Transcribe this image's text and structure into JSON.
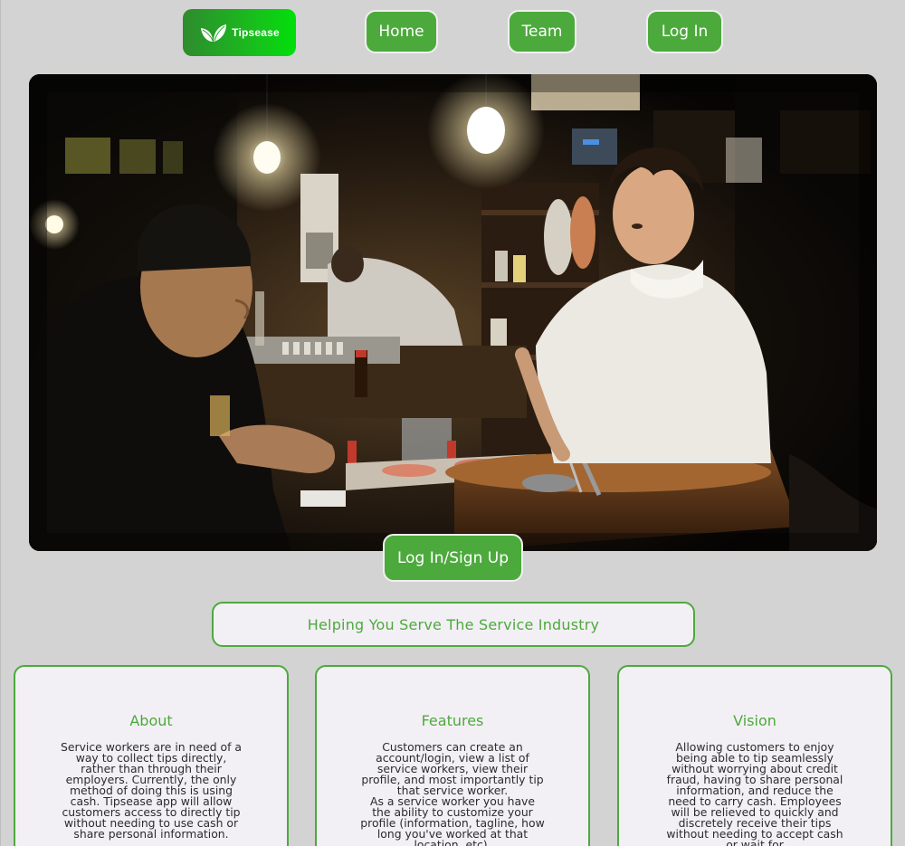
{
  "nav": {
    "logo_text": "Tipsease",
    "home_label": "Home",
    "team_label": "Team",
    "login_label": "Log In"
  },
  "hero": {
    "cta_label": "Log In/Sign Up"
  },
  "tagline": "Helping You Serve The Service Industry",
  "cards": [
    {
      "title": "About",
      "paragraphs": [
        "Service workers are in need of a way to collect tips directly, rather than through their employers. Currently, the only method of doing this is using cash. Tipsease app will allow customers access to directly tip without needing to use cash or share personal information."
      ]
    },
    {
      "title": "Features",
      "paragraphs": [
        "Customers can create an account/login, view a list of service workers, view their profile, and most importantly tip that service worker.",
        "As a service worker you have the ability to customize your profile (information, tagline, how long you've worked at that location, etc)."
      ]
    },
    {
      "title": "Vision",
      "paragraphs": [
        "Allowing customers to enjoy being able to tip seamlessly without worrying about credit fraud, having to share personal information, and reduce the need to carry cash. Employees will be relieved to quickly and discretely receive their tips without needing to accept cash or wait for"
      ]
    }
  ],
  "colors": {
    "accent_green": "#4caa3c",
    "background": "#d3d3d3",
    "card_background": "#f3f0f5"
  },
  "icons": {
    "logo": "leaf-icon"
  }
}
